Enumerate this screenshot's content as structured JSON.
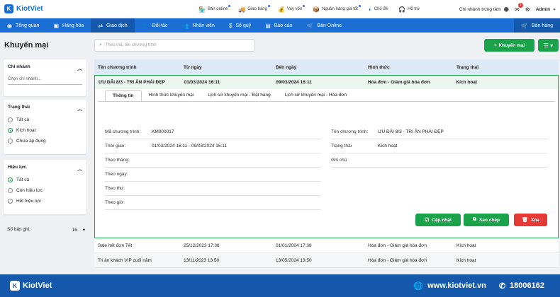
{
  "brand": {
    "name": "KiotViet",
    "logo_letter": "K"
  },
  "top_links": [
    {
      "label": "Bán online",
      "icon": "shop-icon",
      "glyph": "🏪",
      "dot": true
    },
    {
      "label": "Giao hàng",
      "icon": "truck-icon",
      "glyph": "🚚",
      "dot": true
    },
    {
      "label": "Vay vốn",
      "icon": "money-icon",
      "glyph": "💰",
      "dot": true
    },
    {
      "label": "Nguồn hàng giá tốt",
      "icon": "box-icon",
      "glyph": "📦",
      "dot": true
    },
    {
      "label": "Chủ đề",
      "icon": "theme-icon",
      "glyph": "◐",
      "dot": false
    },
    {
      "label": "Hỗ trợ",
      "icon": "headset-icon",
      "glyph": "🎧",
      "dot": false
    }
  ],
  "top_right": {
    "branch": "Chi nhánh trung tâm",
    "notification_count": "1",
    "user": "Admin"
  },
  "nav": [
    {
      "label": "Tổng quan",
      "glyph": "◉",
      "name": "nav-overview"
    },
    {
      "label": "Hàng hóa",
      "glyph": "▣",
      "name": "nav-products"
    },
    {
      "label": "Giao dịch",
      "glyph": "⇄",
      "name": "nav-transactions",
      "active": true
    },
    {
      "label": "Đối tác",
      "glyph": "👤",
      "name": "nav-partners"
    },
    {
      "label": "Nhân viên",
      "glyph": "👥",
      "name": "nav-employees"
    },
    {
      "label": "Sổ quỹ",
      "glyph": "$",
      "name": "nav-cashbook"
    },
    {
      "label": "Báo cáo",
      "glyph": "▤",
      "name": "nav-reports"
    },
    {
      "label": "Bán Online",
      "glyph": "🛒",
      "name": "nav-online"
    }
  ],
  "nav_right": {
    "label": "Bán hàng",
    "glyph": "🛒"
  },
  "page": {
    "title": "Khuyến mại",
    "search_placeholder": "Theo mã, tên chương trình",
    "add_button": "Khuyến mại"
  },
  "filters": {
    "branch": {
      "title": "Chi nhánh",
      "placeholder": "Chọn chi nhánh..."
    },
    "status": {
      "title": "Trạng thái",
      "options": [
        "Tất cả",
        "Kích hoạt",
        "Chưa áp dụng"
      ],
      "selected": 1
    },
    "validity": {
      "title": "Hiệu lực",
      "options": [
        "Tất cả",
        "Còn hiệu lực",
        "Hết hiệu lực"
      ],
      "selected": 0
    },
    "records": {
      "label": "Số bản ghi:",
      "value": "15"
    }
  },
  "table": {
    "columns": [
      "Tên chương trình",
      "Từ ngày",
      "Đến ngày",
      "Hình thức",
      "Trạng thái"
    ],
    "selected_row": [
      "ƯU ĐÃI 8/3 - TRI ÂN PHÁI ĐẸP",
      "01/03/2024 16:11",
      "09/03/2024 16:11",
      "Hóa đơn - Giảm giá hóa đơn",
      "Kích hoạt"
    ],
    "rows": [
      [
        "Sale hết đợn Tết",
        "25/12/2023 17:38",
        "01/01/2024 17:38",
        "Hóa đơn - Giảm giá hóa đơn",
        "Kích hoạt"
      ],
      [
        "Tri ân khách VIP cuối năm",
        "13/11/2023 13:50",
        "13/05/2024 13:50",
        "Hóa đơn - Giảm giá hóa đơn",
        "Kích hoạt"
      ]
    ]
  },
  "detail": {
    "tabs": [
      "Thông tin",
      "Hình thức khuyến mại",
      "Lịch sử khuyến mại - Đặt hàng",
      "Lịch sử khuyến mại - Hóa đơn"
    ],
    "left_fields": [
      {
        "label": "Mã chương trình:",
        "value": "KM000017"
      },
      {
        "label": "Thời gian:",
        "value": "01/03/2024 16:11 - 09/03/2024 16:11"
      },
      {
        "label": "Theo tháng:",
        "value": ""
      },
      {
        "label": "Theo ngày:",
        "value": ""
      },
      {
        "label": "Theo thứ:",
        "value": ""
      },
      {
        "label": "Theo giờ:",
        "value": ""
      }
    ],
    "right_fields": [
      {
        "label": "Tên chương trình:",
        "value": "ƯU ĐÃI 8/3 - TRI ÂN PHÁI ĐẸP"
      },
      {
        "label": "Trạng thái",
        "value": "Kích hoạt"
      },
      {
        "label": "Ghi chú",
        "value": ""
      }
    ],
    "actions": {
      "update": "Cập nhật",
      "copy": "Sao chép",
      "delete": "Xóa"
    }
  },
  "footer": {
    "website": "www.kiotviet.vn",
    "hotline": "18006162"
  },
  "colors": {
    "primary": "#1b6fd4",
    "green": "#1aa34a",
    "red": "#e53935"
  }
}
